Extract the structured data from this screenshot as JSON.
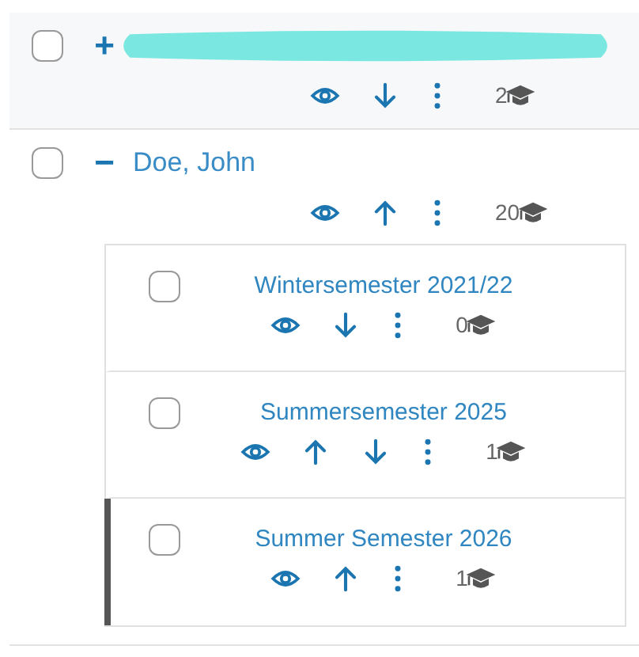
{
  "entries": [
    {
      "checked": false,
      "toggle": "+",
      "expanded": false,
      "name_redacted": true,
      "actions": [
        {
          "kind": "view"
        },
        {
          "kind": "down"
        },
        {
          "kind": "menu"
        }
      ],
      "count": "2"
    },
    {
      "checked": false,
      "toggle": "−",
      "expanded": true,
      "name": "Doe, John",
      "actions": [
        {
          "kind": "view"
        },
        {
          "kind": "up"
        },
        {
          "kind": "menu"
        }
      ],
      "count": "20",
      "children": [
        {
          "checked": false,
          "title": "Wintersemester 2021/22",
          "highlighted": false,
          "actions": [
            {
              "kind": "view"
            },
            {
              "kind": "down"
            },
            {
              "kind": "menu"
            }
          ],
          "count": "0"
        },
        {
          "checked": false,
          "title": "Summersemester 2025",
          "highlighted": false,
          "actions": [
            {
              "kind": "view"
            },
            {
              "kind": "up"
            },
            {
              "kind": "down"
            },
            {
              "kind": "menu"
            }
          ],
          "count": "1"
        },
        {
          "checked": false,
          "title": "Summer Semester 2026",
          "highlighted": true,
          "actions": [
            {
              "kind": "view"
            },
            {
              "kind": "up"
            },
            {
              "kind": "menu"
            }
          ],
          "count": "1"
        }
      ]
    }
  ]
}
